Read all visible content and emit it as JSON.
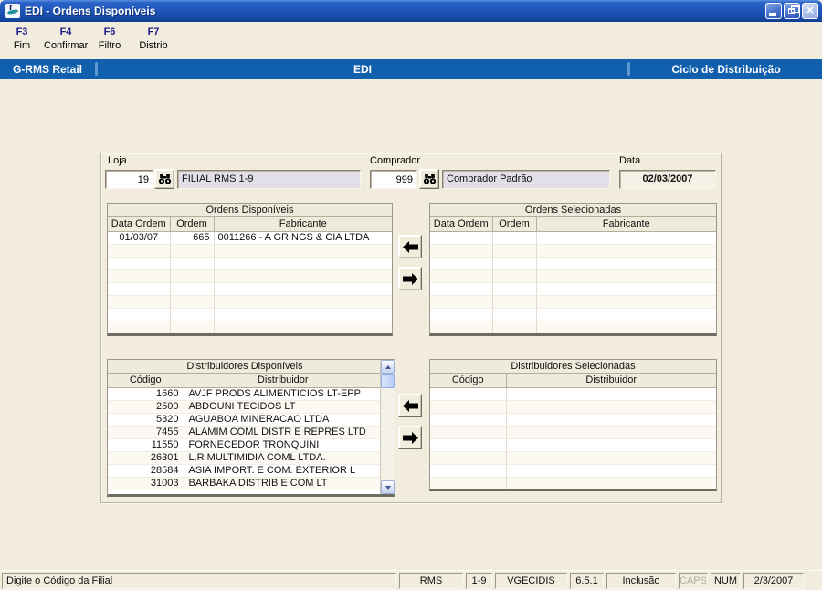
{
  "window": {
    "title": "EDI - Ordens Disponíveis"
  },
  "icons": {
    "window_logo": "rms-logo",
    "search": "binoculars",
    "move_left": "arrow-left",
    "move_right": "arrow-right"
  },
  "toolbar": {
    "items": [
      {
        "key": "F3",
        "label": "Fim"
      },
      {
        "key": "F4",
        "label": "Confirmar"
      },
      {
        "key": "F6",
        "label": "Filtro"
      },
      {
        "key": "F7",
        "label": "Distrib"
      }
    ]
  },
  "menubar": {
    "left": "G-RMS Retail",
    "center": "EDI",
    "right": "Ciclo de Distribuição"
  },
  "form": {
    "loja": {
      "label": "Loja",
      "code": "19",
      "name": "FILIAL RMS 1-9"
    },
    "comprador": {
      "label": "Comprador",
      "code": "999",
      "name": "Comprador Padrão"
    },
    "data": {
      "label": "Data",
      "value": "02/03/2007"
    }
  },
  "orders_available": {
    "title": "Ordens Disponíveis",
    "columns": [
      "Data Ordem",
      "Ordem",
      "Fabricante"
    ],
    "rows": [
      [
        "01/03/07",
        "665",
        "0011266 - A GRINGS & CIA LTDA"
      ]
    ]
  },
  "orders_selected": {
    "title": "Ordens Selecionadas",
    "columns": [
      "Data Ordem",
      "Ordem",
      "Fabricante"
    ],
    "rows": []
  },
  "distributors_available": {
    "title": "Distribuidores Disponíveis",
    "columns": [
      "Código",
      "Distribuidor"
    ],
    "rows": [
      [
        "1660",
        "AVJF PRODS ALIMENTICIOS LT-EPP"
      ],
      [
        "2500",
        "ABDOUNI TECIDOS LT"
      ],
      [
        "5320",
        "AGUABOA MINERACAO LTDA"
      ],
      [
        "7455",
        "ALAMIM COML DISTR E REPRES LTD"
      ],
      [
        "11550",
        "FORNECEDOR TRONQUINI"
      ],
      [
        "26301",
        "L.R MULTIMIDIA COML LTDA."
      ],
      [
        "28584",
        "ASIA IMPORT. E COM. EXTERIOR L"
      ],
      [
        "31003",
        "BARBAKA DISTRIB E COM LT"
      ]
    ]
  },
  "distributors_selected": {
    "title": "Distribuidores Selecionadas",
    "columns": [
      "Código",
      "Distribuidor"
    ],
    "rows": []
  },
  "statusbar": {
    "message": "Digite o Código da Filial",
    "segments": [
      "RMS",
      "1-9",
      "VGECIDIS",
      "6.5.1",
      "Inclusão",
      "CAPS",
      "NUM",
      "2/3/2007"
    ]
  },
  "colors": {
    "titlebar_blue": "#1f57bc",
    "menubar_blue": "#1160ae",
    "background_beige": "#f1ecdd",
    "readonly_field": "#e2dfe9",
    "fkey_navy": "#1b1b8a"
  }
}
